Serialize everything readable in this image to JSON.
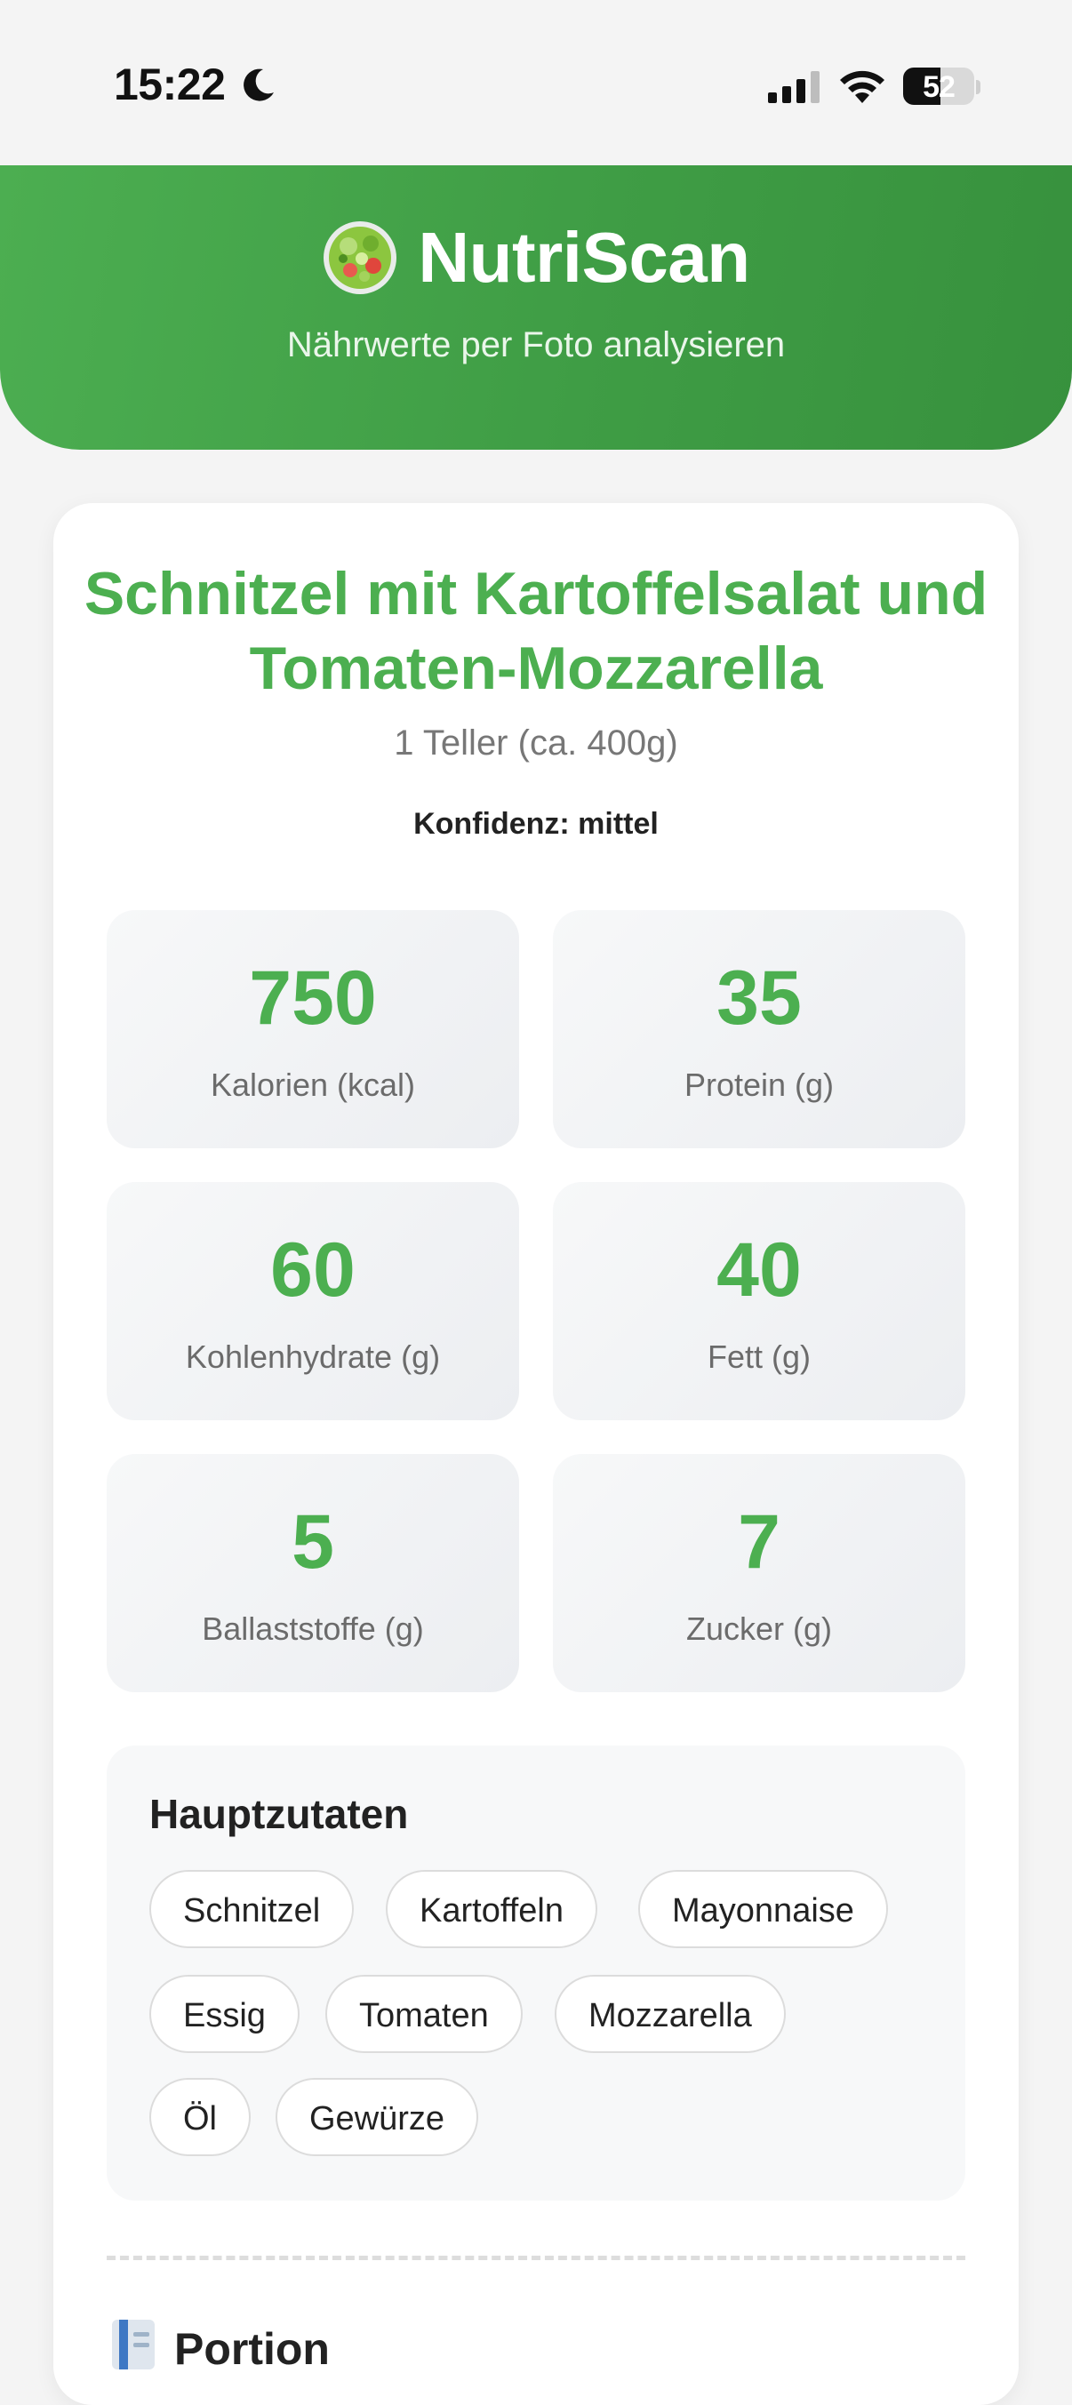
{
  "status_bar": {
    "time": "15:22",
    "battery": "52",
    "battery_level": 0.52
  },
  "header": {
    "title": "NutriScan",
    "subtitle": "Nährwerte per Foto analysieren"
  },
  "result": {
    "dish_name": "Schnitzel mit Kartoffelsalat und Tomaten-Mozzarella",
    "portion": "1 Teller (ca. 400g)",
    "confidence": "Konfidenz: mittel",
    "nutrients": [
      {
        "value": "750",
        "label": "Kalorien (kcal)"
      },
      {
        "value": "35",
        "label": "Protein (g)"
      },
      {
        "value": "60",
        "label": "Kohlenhydrate (g)"
      },
      {
        "value": "40",
        "label": "Fett (g)"
      },
      {
        "value": "5",
        "label": "Ballaststoffe (g)"
      },
      {
        "value": "7",
        "label": "Zucker (g)"
      }
    ],
    "ingredients_title": "Hauptzutaten",
    "ingredients": [
      "Schnitzel",
      "Kartoffeln",
      "Mayonnaise",
      "Essig",
      "Tomaten",
      "Mozzarella",
      "Öl",
      "Gewürze"
    ],
    "next_section_title": "Portion"
  },
  "colors": {
    "brand_green": "#4caf50",
    "header_green": "#3f9d45"
  }
}
